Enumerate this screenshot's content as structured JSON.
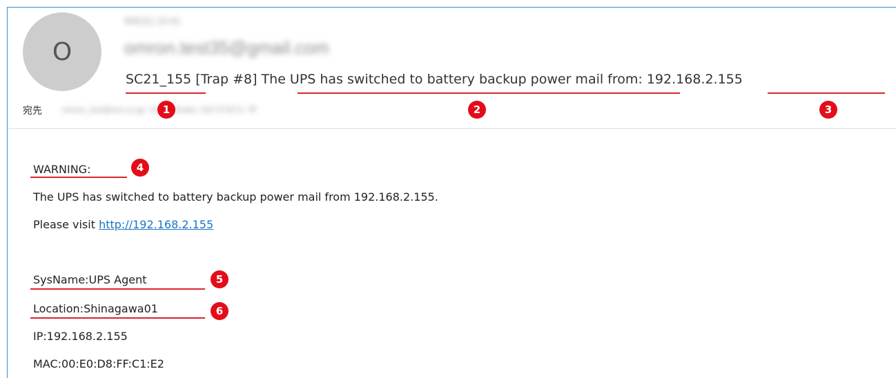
{
  "header": {
    "avatar_initial": "O",
    "date": "9/9(火) 10:41",
    "sender": "omron.test35@gmail.com",
    "subject": "SC21_155 [Trap #8] The UPS has switched to battery backup power mail from: 192.168.2.155",
    "to_label": "宛先",
    "to_value": "omron_test@xxx.co.jp; Yuichi Hirata; 192.073271; 中"
  },
  "body": {
    "warning": "WARNING:",
    "line1": "The UPS has switched to battery backup power mail from 192.168.2.155.",
    "visit_prefix": "Please visit ",
    "visit_link": "http://192.168.2.155",
    "sysname": "SysName:UPS Agent",
    "location": "Location:Shinagawa01",
    "ip": "IP:192.168.2.155",
    "mac": "MAC:00:E0:D8:FF:C1:E2"
  },
  "badges": [
    "1",
    "2",
    "3",
    "4",
    "5",
    "6"
  ],
  "colors": {
    "accent_border": "#3b8fd0",
    "annotation_red": "#e30d19",
    "link": "#1a73c8"
  }
}
